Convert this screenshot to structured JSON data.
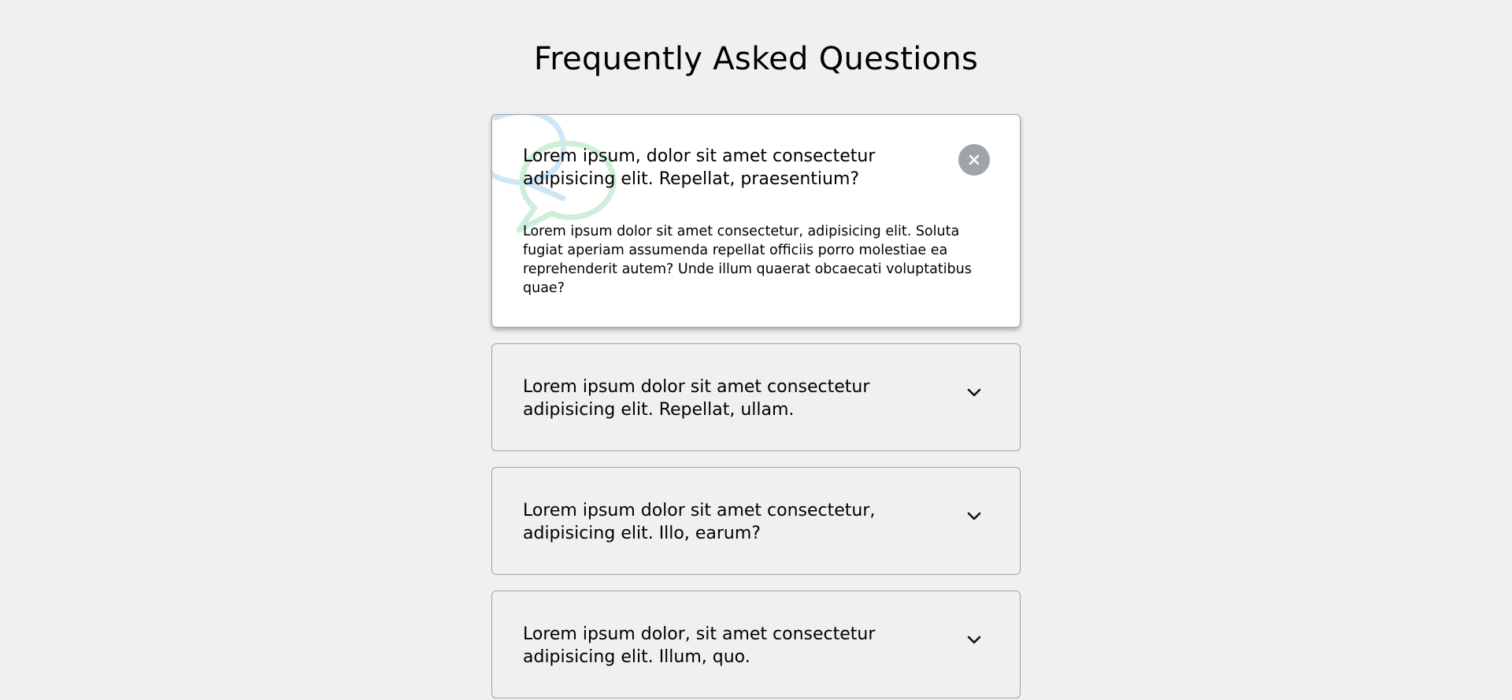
{
  "page": {
    "title": "Frequently Asked Questions",
    "background": "#f0f0f0"
  },
  "faqs": [
    {
      "question": "Lorem ipsum, dolor sit amet consectetur adipisicing elit. Repellat, praesentium?",
      "answer": "Lorem ipsum dolor sit amet consectetur, adipisicing elit. Soluta fugiat aperiam assumenda repellat officiis porro molestiae ea reprehenderit autem? Unde illum quaerat obcaecati voluptatibus quae?",
      "state": "open",
      "toggle_icon": "close-icon"
    },
    {
      "question": "Lorem ipsum dolor sit amet consectetur adipisicing elit. Repellat, ullam.",
      "state": "collapsed",
      "toggle_icon": "chevron-down-icon"
    },
    {
      "question": "Lorem ipsum dolor sit amet consectetur, adipisicing elit. Illo, earum?",
      "state": "collapsed",
      "toggle_icon": "chevron-down-icon"
    },
    {
      "question": "Lorem ipsum dolor, sit amet consectetur adipisicing elit. Illum, quo.",
      "state": "collapsed",
      "toggle_icon": "chevron-down-icon"
    }
  ],
  "colors": {
    "card_border": "#9fa4a8",
    "active_card_bg": "#ffffff",
    "close_button_bg": "#9fa4a8",
    "deco_blue": "#cfe6f7",
    "deco_green": "#cdeed8"
  }
}
